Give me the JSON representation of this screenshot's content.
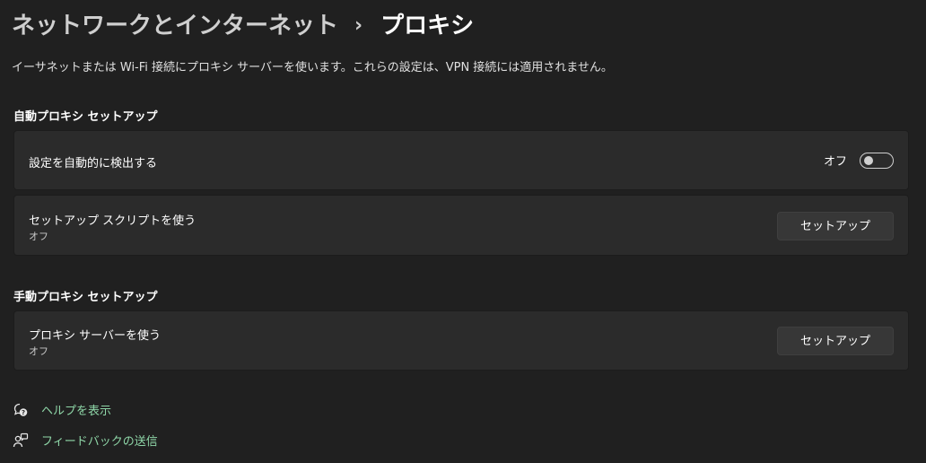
{
  "breadcrumb": {
    "parent": "ネットワークとインターネット",
    "separator": "›",
    "current": "プロキシ"
  },
  "description": "イーサネットまたは Wi-Fi 接続にプロキシ サーバーを使います。これらの設定は、VPN 接続には適用されません。",
  "auto_section": {
    "title": "自動プロキシ セットアップ",
    "detect": {
      "label": "設定を自動的に検出する",
      "state_text": "オフ",
      "toggle_on": false
    },
    "script": {
      "label": "セットアップ スクリプトを使う",
      "status": "オフ",
      "button_label": "セットアップ"
    }
  },
  "manual_section": {
    "title": "手動プロキシ セットアップ",
    "proxy": {
      "label": "プロキシ サーバーを使う",
      "status": "オフ",
      "button_label": "セットアップ"
    }
  },
  "links": {
    "help": {
      "label": "ヘルプを表示",
      "icon": "help-chat-icon"
    },
    "feedback": {
      "label": "フィードバックの送信",
      "icon": "feedback-person-icon"
    }
  },
  "colors": {
    "background": "#202020",
    "card": "#2b2b2b",
    "link": "#8fd7a8"
  }
}
